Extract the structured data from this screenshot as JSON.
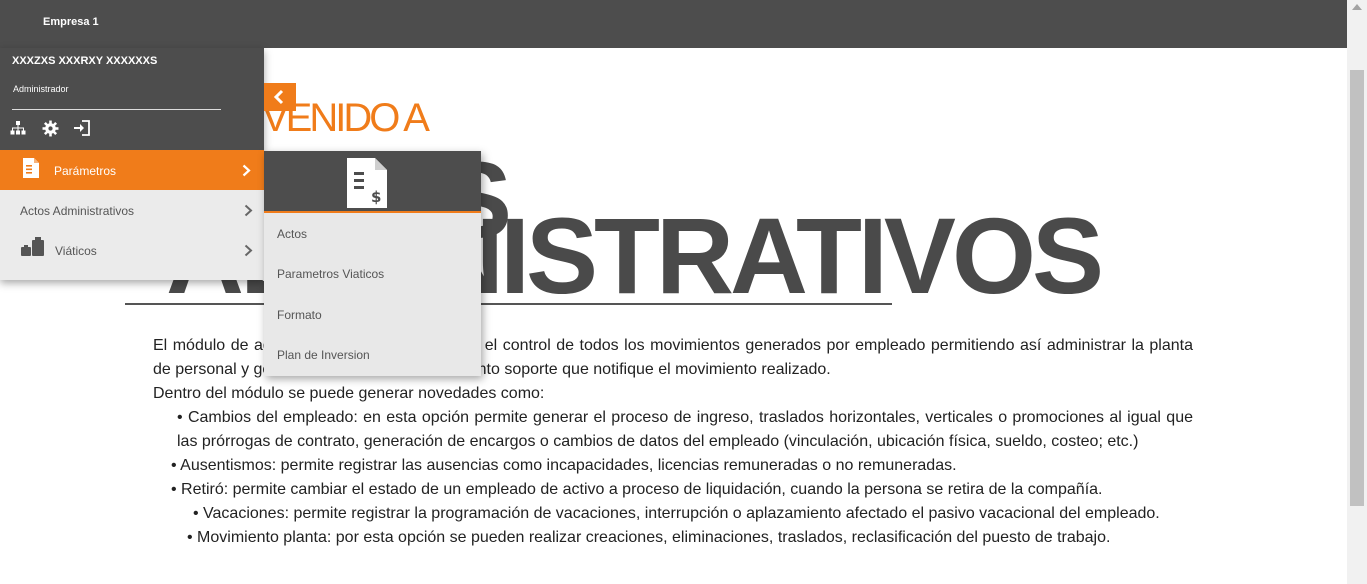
{
  "header": {
    "company": "Empresa 1"
  },
  "user": {
    "name": "XXXZXS XXXRXY XXXXXXS",
    "role": "Administrador"
  },
  "profile_icons": [
    "sitemap-icon",
    "gear-icon",
    "sign-out-icon"
  ],
  "sidebar": {
    "active": {
      "label": "Parámetros",
      "icon": "document-icon"
    },
    "items": [
      {
        "label": "Actos Administrativos"
      },
      {
        "label": "Viáticos",
        "icon": "suitcase-icon"
      }
    ]
  },
  "submenu": {
    "icon": "document-dollar-icon",
    "items": [
      {
        "label": "Actos"
      },
      {
        "label": "Parametros Viaticos"
      },
      {
        "label": "Formato"
      },
      {
        "label": "Plan de Inversion"
      }
    ]
  },
  "main": {
    "welcome_small": "VENIDO A",
    "welcome_big": "ADMINISTRATIVOS",
    "welcome_s": "S",
    "para1": "El módulo de administrativos permite obtener el control de todos los movimientos generados por empleado permitiendo así administrar la planta de personal y generar la resolución o documento soporte que notifique el movimiento realizado.",
    "para2": "Dentro del módulo se puede generar novedades como:",
    "bullet1": "•  Cambios del empleado: en esta opción permite generar el proceso de ingreso, traslados horizontales, verticales o promociones al igual que las prórrogas de contrato, generación de encargos o cambios de datos del empleado (vinculación, ubicación física, sueldo, costeo; etc.)",
    "bullet2": "•  Ausentismos: permite registrar las ausencias como incapacidades, licencias remuneradas o no remuneradas.",
    "bullet3": "•  Retiró: permite cambiar el estado de un empleado de activo a proceso de liquidación, cuando la persona se retira de la compañía.",
    "bullet4": "•  Vacaciones: permite registrar la programación de vacaciones, interrupción o aplazamiento afectado el pasivo vacacional del empleado.",
    "bullet5": "•  Movimiento planta: por esta opción se pueden realizar creaciones, eliminaciones, traslados, reclasificación del puesto de trabajo."
  },
  "colors": {
    "accent": "#f07c1a",
    "dark": "#4d4d4d",
    "menu_bg": "#ebebeb"
  }
}
